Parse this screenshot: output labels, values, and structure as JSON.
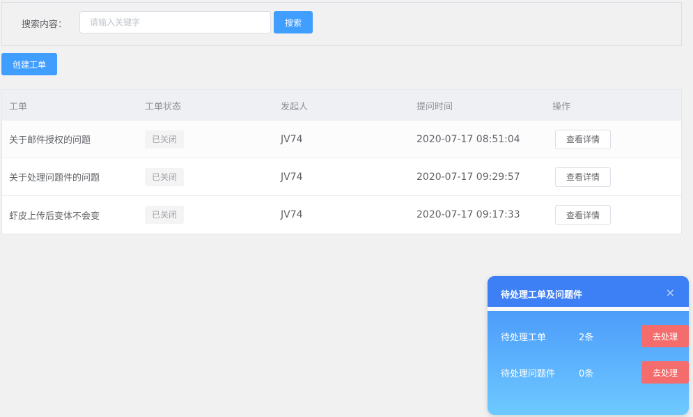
{
  "search": {
    "label": "搜索内容：",
    "placeholder": "请输入关键字",
    "value": "",
    "button_label": "搜索"
  },
  "toolbar": {
    "create_label": "创建工单"
  },
  "table": {
    "columns": [
      "工单",
      "工单状态",
      "发起人",
      "提问时间",
      "操作"
    ],
    "rows": [
      {
        "title": "关于邮件授权的问题",
        "status": "已关闭",
        "initiator": "JV74",
        "time": "2020-07-17 08:51:04",
        "action": "查看详情"
      },
      {
        "title": "关于处理问题件的问题",
        "status": "已关闭",
        "initiator": "JV74",
        "time": "2020-07-17 09:29:57",
        "action": "查看详情"
      },
      {
        "title": "虾皮上传后变体不会变",
        "status": "已关闭",
        "initiator": "JV74",
        "time": "2020-07-17 09:17:33",
        "action": "查看详情"
      }
    ]
  },
  "popup": {
    "title": "待处理工单及问题件",
    "close_icon": "×",
    "items": [
      {
        "label": "待处理工单",
        "count": "2条",
        "button": "去处理"
      },
      {
        "label": "待处理问题件",
        "count": "0条",
        "button": "去处理"
      }
    ]
  },
  "colors": {
    "primary": "#409eff",
    "danger": "#f56c6c",
    "popup_header": "#3d7ff4"
  }
}
